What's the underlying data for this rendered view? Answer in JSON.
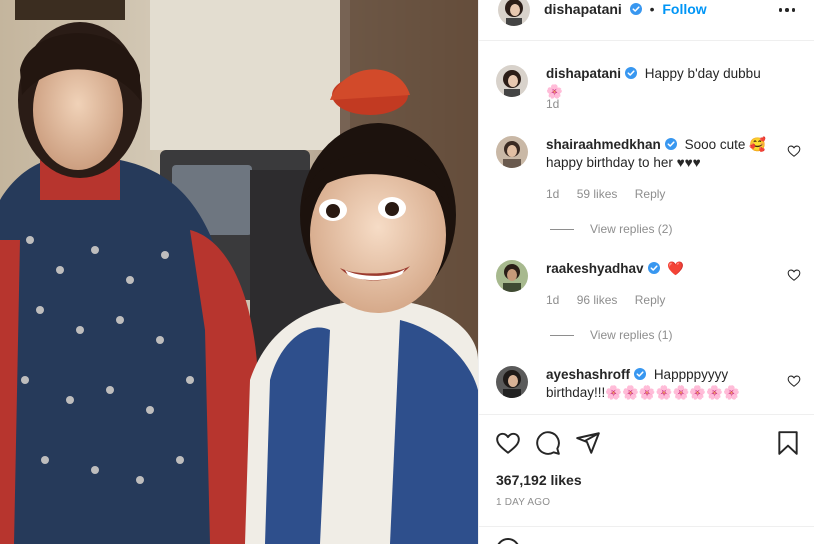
{
  "post": {
    "username": "dishapatani",
    "follow_label": "Follow",
    "separator": "•"
  },
  "caption": {
    "username": "dishapatani",
    "text": "Happy b'day dubbu🌸",
    "time": "1d"
  },
  "comments": [
    {
      "username": "shairaahmedkhan",
      "text": "Sooo cute 🥰 happy birthday to her ♥♥♥",
      "time": "1d",
      "likes": "59 likes",
      "reply_label": "Reply",
      "view_replies": "View replies (2)"
    },
    {
      "username": "raakeshyadhav",
      "text": "❤️",
      "time": "1d",
      "likes": "96 likes",
      "reply_label": "Reply",
      "view_replies": "View replies (1)"
    },
    {
      "username": "ayeshashroff",
      "text": "Happppyyyy birthday!!!🌸🌸🌸🌸🌸🌸🌸🌸"
    }
  ],
  "footer": {
    "likes": "367,192 likes",
    "time_ago": "1 DAY AGO"
  },
  "icons": {
    "verified": "verified-badge-icon",
    "heart": "heart-icon",
    "comment": "comment-icon",
    "share": "share-icon",
    "save": "bookmark-icon",
    "more": "more-options-icon"
  },
  "colors": {
    "accent": "#0095f6",
    "verified": "#3897f0",
    "muted": "#8e8e8e",
    "text": "#262626"
  }
}
